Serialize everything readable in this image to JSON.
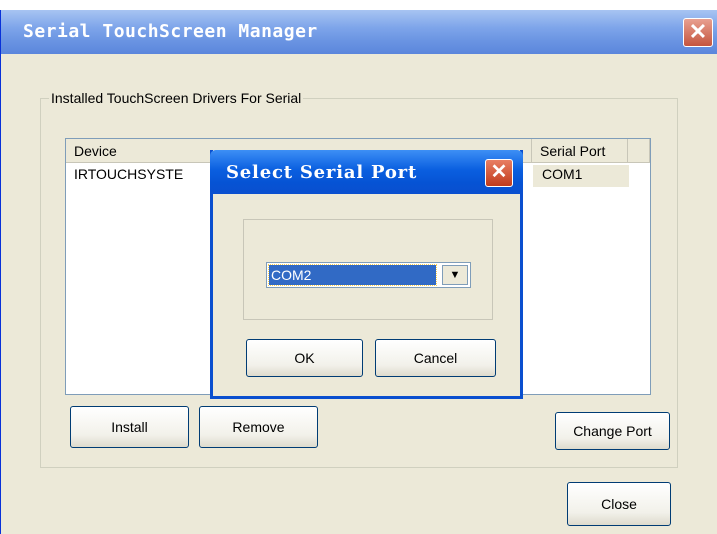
{
  "main_window": {
    "title": "Serial TouchScreen Manager",
    "close_glyph": "✕",
    "group_label": "Installed TouchScreen Drivers For Serial",
    "columns": [
      "Device",
      "Serial Port"
    ],
    "rows": [
      {
        "device": "IRTOUCHSYSTE",
        "port": "COM1"
      }
    ],
    "buttons": {
      "install": "Install",
      "remove": "Remove",
      "change_port": "Change Port",
      "close": "Close"
    }
  },
  "dialog": {
    "title": "Select Serial Port",
    "close_glyph": "✕",
    "selected_port": "COM2",
    "dropdown_glyph": "▼",
    "buttons": {
      "ok": "OK",
      "cancel": "Cancel"
    }
  },
  "colors": {
    "titlebar_inactive": "#7ea5ea",
    "titlebar_active": "#0a5fe0",
    "window_bg": "#ece9d8",
    "selection": "#316ac5"
  }
}
